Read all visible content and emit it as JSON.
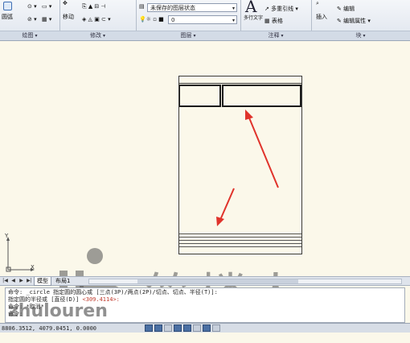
{
  "ribbon": {
    "panels": [
      {
        "name": "draw",
        "title": "绘图"
      },
      {
        "name": "modify",
        "title": "修改"
      },
      {
        "name": "layers",
        "title": "图层"
      },
      {
        "name": "annotation",
        "title": "注释"
      },
      {
        "name": "block",
        "title": "块"
      }
    ],
    "draw_tools": {
      "circle": "圆弧"
    },
    "modify_tools": {
      "move": "移动"
    },
    "layer_state": "未保存的图层状态",
    "current_layer": "0",
    "annotation_tools": {
      "multiline_text": "多行文字",
      "multileader": "多重引线",
      "table": "表格"
    },
    "block_tools": {
      "insert": "插入",
      "edit": "编辑",
      "edit_attributes": "编辑属性"
    }
  },
  "tabs": {
    "items": [
      "模型",
      "布局1"
    ]
  },
  "command": {
    "lines": [
      {
        "prefix": "命令:",
        "text": "_circle 指定圆的圆心或 [三点(3P)/两点(2P)/切点、切点、半径(T)]:"
      },
      {
        "prefix": "指定圆的半径或 [直径(D)]",
        "text": "<309.4114>:"
      },
      {
        "prefix": "命令:",
        "text": "*取消*"
      },
      {
        "prefix": "命令:",
        "text": ""
      }
    ]
  },
  "status": {
    "coords": "8806.3512, 4079.0451, 0.0000"
  },
  "watermark": {
    "cn": "筑楼人",
    "en": "zhulouren"
  },
  "colors": {
    "canvas_bg": "#fbf8ea",
    "arrow": "#e0332b",
    "ribbon_bg": "#e6ebf2"
  }
}
